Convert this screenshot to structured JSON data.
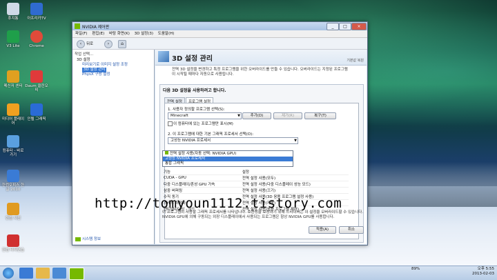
{
  "desktop_icons": [
    {
      "label": "휴지통",
      "icon": "recycle-bin-icon",
      "color": "#cfd9e6"
    },
    {
      "label": "아프리카TV",
      "icon": "afreecatv-icon",
      "color": "#2f6bd0"
    },
    {
      "label": "V3 Lite",
      "icon": "v3-icon",
      "color": "#1f9f4a"
    },
    {
      "label": "Chrome",
      "icon": "chrome-icon",
      "color": "#e04a3a"
    },
    {
      "label": "메신저 센터",
      "icon": "messenger-icon",
      "color": "#e0a020"
    },
    {
      "label": "Daum 클린오피",
      "icon": "daum-icon",
      "color": "#e03a3a"
    },
    {
      "label": "미디어 플레이어",
      "icon": "media-icon",
      "color": "#f0a020"
    },
    {
      "label": "인텔 그래픽",
      "icon": "intel-icon",
      "color": "#2a6bd6"
    },
    {
      "label": "컴퓨터 - 바로 가기",
      "icon": "computer-icon",
      "color": "#5aa0e0"
    },
    {
      "label": "한컴오피스 한글 2010",
      "icon": "hancom-icon",
      "color": "#3a7bd5"
    },
    {
      "label": "한컴 사전",
      "icon": "dictionary-icon",
      "color": "#e09a20"
    },
    {
      "label": "한컴 타자연습",
      "icon": "typing-icon",
      "color": "#d03030"
    }
  ],
  "window": {
    "title": "NVIDIA 제어판",
    "menu": [
      "파일(F)",
      "편집(E)",
      "바탕 화면(K)",
      "3D 설정(3)",
      "도움말(H)"
    ],
    "nav_back": "뒤로"
  },
  "left": {
    "header": "작업 선택...",
    "items": [
      {
        "label": "3D 설정"
      },
      {
        "label": "미리보기로 이미지 설정 조정"
      },
      {
        "label": "3D 설정 관리"
      },
      {
        "label": "PhysX 구성 설정"
      }
    ],
    "system_info": "시스템 정보"
  },
  "main": {
    "title": "3D 설정 관리",
    "restore": "기본값 복원",
    "desc": "전역 3D 설정을 변경하고 특정 프로그램을 위한 오버라이드를 만들 수 있습니다. 오버라이드는 지정된 프로그램이 시작될 때마다 자동으로 사용됩니다.",
    "box_caption": "다음 3D 설정을 사용하려고 합니다.",
    "tabs": [
      "전역 설정",
      "프로그램 설정"
    ],
    "step1": "1. 사용자 정의할 프로그램 선택(S):",
    "program": "Minecraft",
    "add": "추가(D)",
    "remove": "제거(R)",
    "restore_btn": "복구(T)",
    "show_only": "이 컴퓨터에 있는 프로그램만 표시(M)",
    "step2": "2. 이 프로그램에 대한 기본 그래픽 프로세서 선택(O):",
    "processor": "고성능 NVIDIA 프로세서",
    "dropdown": [
      "전역 설정 사용(자동 선택: NVIDIA GPU)",
      "고성능 NVIDIA 프로세서",
      "통합 그래픽"
    ],
    "settings_header": [
      "기능",
      "설정"
    ],
    "settings": [
      [
        "CUDA - GPU",
        "전역 설정 사용(모두)"
      ],
      [
        "다중 디스플레이/혼성 GPU 가속",
        "전역 설정 사용(다중 디스플레이 성능 모드)"
      ],
      [
        "삼중 버퍼링",
        "전역 설정 사용(끄기)"
      ],
      [
        "수직 동기",
        "전역 설정 사용(3D 응용 프로그램 설정 사용)"
      ],
      [
        "스레드 최적화",
        "전역 설정 사용(자동)"
      ],
      [
        "앤티앨리어싱 - 모드",
        "전역 설정 사용(응용 프로그램 제어)"
      ]
    ],
    "bottom": "이 프로그램이 사용할 그래픽 프로세서를 나타냅니다. 호환성을 보장하기 위해 드라이버는 이 설정을 오버라이드할 수 있습니다. NVIDIA GPU에 의해 구동되는 외장 디스플레이에서 사용되는 프로그램은 항상 NVIDIA GPU를 사용합니다.",
    "apply": "적용(A)",
    "cancel": "취소"
  },
  "watermark": "http://tomyoun1112.tistory.com",
  "taskbar": {
    "time": "오후 5:55",
    "date": "2013-02-03",
    "battery": "89%"
  }
}
